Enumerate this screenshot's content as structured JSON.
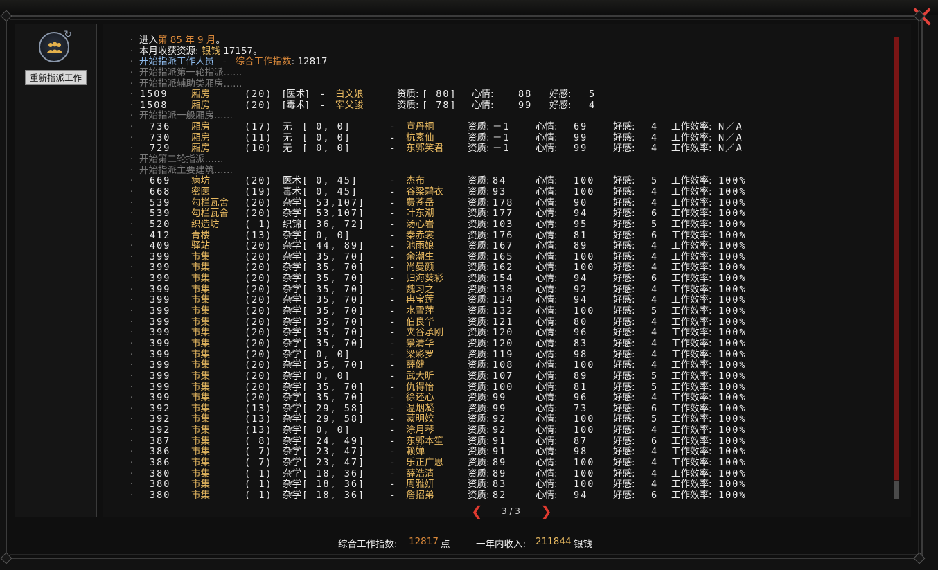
{
  "left_panel": {
    "reassign_label": "重新指派工作",
    "reassign_icon": "people-refresh-icon"
  },
  "log": [
    {
      "t": "text",
      "parts": [
        {
          "s": "进入",
          "c": "white"
        },
        {
          "s": "第 85 年 9 月",
          "c": "orange"
        },
        {
          "s": "。",
          "c": "white"
        }
      ]
    },
    {
      "t": "text",
      "parts": [
        {
          "s": "本月收获资源: ",
          "c": "white"
        },
        {
          "s": "银钱",
          "c": "gold"
        },
        {
          "s": " 17157。",
          "c": "white"
        }
      ]
    },
    {
      "t": "text",
      "parts": [
        {
          "s": "开始指派工作人员",
          "c": "blue"
        },
        {
          "s": "   -   ",
          "c": "gray"
        },
        {
          "s": "综合工作指数",
          "c": "orange"
        },
        {
          "s": ": 12817",
          "c": "white"
        }
      ]
    },
    {
      "t": "text",
      "parts": [
        {
          "s": "开始指派第一轮指派……",
          "c": "gray"
        }
      ]
    },
    {
      "t": "text",
      "parts": [
        {
          "s": "开始指派辅助类厢房……",
          "c": "gray"
        }
      ]
    },
    {
      "t": "aux",
      "id": "1509",
      "b": "厢房",
      "lv": "(20)",
      "skill": "[医术]",
      "name": "白文娘",
      "q": "[  80]",
      "mood": "88",
      "fav": "5"
    },
    {
      "t": "aux",
      "id": "1508",
      "b": "厢房",
      "lv": "(20)",
      "skill": "[毒术]",
      "name": "宰父骏",
      "q": "[  78]",
      "mood": "99",
      "fav": "4"
    },
    {
      "t": "text",
      "parts": [
        {
          "s": "开始指派一般厢房……",
          "c": "gray"
        }
      ]
    },
    {
      "t": "row",
      "id": "736",
      "b": "厢房",
      "lv": "(17)",
      "skill": "无",
      "rng": "[   0,    0]",
      "name": "宣丹桐",
      "q": "－1",
      "mood": "69",
      "fav": "4",
      "eff": "N／A"
    },
    {
      "t": "row",
      "id": "730",
      "b": "厢房",
      "lv": "(11)",
      "skill": "无",
      "rng": "[   0,    0]",
      "name": "杭素仙",
      "q": "－1",
      "mood": "99",
      "fav": "4",
      "eff": "N／A"
    },
    {
      "t": "row",
      "id": "729",
      "b": "厢房",
      "lv": "(10)",
      "skill": "无",
      "rng": "[   0,    0]",
      "name": "东郭笑君",
      "q": "－1",
      "mood": "99",
      "fav": "4",
      "eff": "N／A"
    },
    {
      "t": "text",
      "parts": [
        {
          "s": "开始第二轮指派……",
          "c": "gray"
        }
      ]
    },
    {
      "t": "text",
      "parts": [
        {
          "s": "开始指派主要建筑……",
          "c": "gray"
        }
      ]
    },
    {
      "t": "row",
      "id": "669",
      "b": "病坊",
      "lv": "(20)",
      "skill": "医术",
      "rng": "[   0,  45]",
      "name": "杰布",
      "q": "84",
      "mood": "100",
      "fav": "5",
      "eff": "100%"
    },
    {
      "t": "row",
      "id": "668",
      "b": "密医",
      "lv": "(19)",
      "skill": "毒术",
      "rng": "[   0,  45]",
      "name": "谷梁碧衣",
      "q": "93",
      "mood": "100",
      "fav": "4",
      "eff": "100%"
    },
    {
      "t": "row",
      "id": "539",
      "b": "勾栏瓦舍",
      "lv": "(20)",
      "skill": "杂学",
      "rng": "[ 53,107]",
      "name": "费苍岳",
      "q": "178",
      "mood": "90",
      "fav": "4",
      "eff": "100%"
    },
    {
      "t": "row",
      "id": "539",
      "b": "勾栏瓦舍",
      "lv": "(20)",
      "skill": "杂学",
      "rng": "[ 53,107]",
      "name": "叶东潮",
      "q": "177",
      "mood": "94",
      "fav": "6",
      "eff": "100%"
    },
    {
      "t": "row",
      "id": "520",
      "b": "织造坊",
      "lv": "(  1)",
      "skill": "织锦",
      "rng": "[ 36,  72]",
      "name": "汤心岩",
      "q": "103",
      "mood": "95",
      "fav": "5",
      "eff": "100%"
    },
    {
      "t": "row",
      "id": "412",
      "b": "青楼",
      "lv": "(13)",
      "skill": "杂学",
      "rng": "[   0,    0]",
      "name": "秦赤裳",
      "q": "176",
      "mood": "81",
      "fav": "6",
      "eff": "100%"
    },
    {
      "t": "row",
      "id": "409",
      "b": "驿站",
      "lv": "(20)",
      "skill": "杂学",
      "rng": "[ 44,  89]",
      "name": "池雨娘",
      "q": "167",
      "mood": "89",
      "fav": "4",
      "eff": "100%"
    },
    {
      "t": "row",
      "id": "399",
      "b": "市集",
      "lv": "(20)",
      "skill": "杂学",
      "rng": "[ 35,  70]",
      "name": "余潮生",
      "q": "165",
      "mood": "100",
      "fav": "4",
      "eff": "100%"
    },
    {
      "t": "row",
      "id": "399",
      "b": "市集",
      "lv": "(20)",
      "skill": "杂学",
      "rng": "[ 35,  70]",
      "name": "尚曼颜",
      "q": "162",
      "mood": "100",
      "fav": "4",
      "eff": "100%"
    },
    {
      "t": "row",
      "id": "399",
      "b": "市集",
      "lv": "(20)",
      "skill": "杂学",
      "rng": "[ 35,  70]",
      "name": "归海葵彩",
      "q": "154",
      "mood": "94",
      "fav": "6",
      "eff": "100%"
    },
    {
      "t": "row",
      "id": "399",
      "b": "市集",
      "lv": "(20)",
      "skill": "杂学",
      "rng": "[ 35,  70]",
      "name": "魏习之",
      "q": "138",
      "mood": "92",
      "fav": "4",
      "eff": "100%"
    },
    {
      "t": "row",
      "id": "399",
      "b": "市集",
      "lv": "(20)",
      "skill": "杂学",
      "rng": "[ 35,  70]",
      "name": "冉宝莲",
      "q": "134",
      "mood": "94",
      "fav": "4",
      "eff": "100%"
    },
    {
      "t": "row",
      "id": "399",
      "b": "市集",
      "lv": "(20)",
      "skill": "杂学",
      "rng": "[ 35,  70]",
      "name": "水雪萍",
      "q": "132",
      "mood": "100",
      "fav": "5",
      "eff": "100%"
    },
    {
      "t": "row",
      "id": "399",
      "b": "市集",
      "lv": "(20)",
      "skill": "杂学",
      "rng": "[ 35,  70]",
      "name": "伯良华",
      "q": "121",
      "mood": "80",
      "fav": "4",
      "eff": "100%"
    },
    {
      "t": "row",
      "id": "399",
      "b": "市集",
      "lv": "(20)",
      "skill": "杂学",
      "rng": "[ 35,  70]",
      "name": "夹谷承刚",
      "q": "120",
      "mood": "96",
      "fav": "4",
      "eff": "100%"
    },
    {
      "t": "row",
      "id": "399",
      "b": "市集",
      "lv": "(20)",
      "skill": "杂学",
      "rng": "[ 35,  70]",
      "name": "景清华",
      "q": "120",
      "mood": "83",
      "fav": "4",
      "eff": "100%"
    },
    {
      "t": "row",
      "id": "399",
      "b": "市集",
      "lv": "(20)",
      "skill": "杂学",
      "rng": "[   0,    0]",
      "name": "梁彩罗",
      "q": "119",
      "mood": "98",
      "fav": "4",
      "eff": "100%"
    },
    {
      "t": "row",
      "id": "399",
      "b": "市集",
      "lv": "(20)",
      "skill": "杂学",
      "rng": "[ 35,  70]",
      "name": "薛健",
      "q": "108",
      "mood": "100",
      "fav": "4",
      "eff": "100%"
    },
    {
      "t": "row",
      "id": "399",
      "b": "市集",
      "lv": "(20)",
      "skill": "杂学",
      "rng": "[   0,    0]",
      "name": "武大昕",
      "q": "107",
      "mood": "89",
      "fav": "5",
      "eff": "100%"
    },
    {
      "t": "row",
      "id": "399",
      "b": "市集",
      "lv": "(20)",
      "skill": "杂学",
      "rng": "[ 35,  70]",
      "name": "仇得怡",
      "q": "100",
      "mood": "81",
      "fav": "5",
      "eff": "100%"
    },
    {
      "t": "row",
      "id": "399",
      "b": "市集",
      "lv": "(20)",
      "skill": "杂学",
      "rng": "[ 35,  70]",
      "name": "徐还心",
      "q": "99",
      "mood": "96",
      "fav": "4",
      "eff": "100%"
    },
    {
      "t": "row",
      "id": "392",
      "b": "市集",
      "lv": "(13)",
      "skill": "杂学",
      "rng": "[ 29,  58]",
      "name": "温烟凝",
      "q": "99",
      "mood": "73",
      "fav": "6",
      "eff": "100%"
    },
    {
      "t": "row",
      "id": "392",
      "b": "市集",
      "lv": "(13)",
      "skill": "杂学",
      "rng": "[ 29,  58]",
      "name": "蒙明姣",
      "q": "92",
      "mood": "100",
      "fav": "5",
      "eff": "100%"
    },
    {
      "t": "row",
      "id": "392",
      "b": "市集",
      "lv": "(13)",
      "skill": "杂学",
      "rng": "[   0,    0]",
      "name": "涂月琴",
      "q": "92",
      "mood": "100",
      "fav": "4",
      "eff": "100%"
    },
    {
      "t": "row",
      "id": "387",
      "b": "市集",
      "lv": "(  8)",
      "skill": "杂学",
      "rng": "[ 24,  49]",
      "name": "东郭本笙",
      "q": "91",
      "mood": "87",
      "fav": "6",
      "eff": "100%"
    },
    {
      "t": "row",
      "id": "386",
      "b": "市集",
      "lv": "(  7)",
      "skill": "杂学",
      "rng": "[ 23,  47]",
      "name": "赖婵",
      "q": "91",
      "mood": "98",
      "fav": "4",
      "eff": "100%"
    },
    {
      "t": "row",
      "id": "386",
      "b": "市集",
      "lv": "(  7)",
      "skill": "杂学",
      "rng": "[ 23,  47]",
      "name": "乐正广思",
      "q": "89",
      "mood": "100",
      "fav": "4",
      "eff": "100%"
    },
    {
      "t": "row",
      "id": "380",
      "b": "市集",
      "lv": "(  1)",
      "skill": "杂学",
      "rng": "[ 18,  36]",
      "name": "薛浩清",
      "q": "89",
      "mood": "100",
      "fav": "4",
      "eff": "100%"
    },
    {
      "t": "row",
      "id": "380",
      "b": "市集",
      "lv": "(  1)",
      "skill": "杂学",
      "rng": "[ 18,  36]",
      "name": "周雅妍",
      "q": "83",
      "mood": "100",
      "fav": "4",
      "eff": "100%"
    },
    {
      "t": "row",
      "id": "380",
      "b": "市集",
      "lv": "(  1)",
      "skill": "杂学",
      "rng": "[ 18,  36]",
      "name": "詹招弟",
      "q": "82",
      "mood": "94",
      "fav": "6",
      "eff": "100%"
    }
  ],
  "labels": {
    "q": "资质:",
    "mood": "心情:",
    "fav": "好感:",
    "eff": "工作效率:",
    "dash": "-"
  },
  "pager": {
    "text": "3 / 3",
    "prev": "❮",
    "next": "❯"
  },
  "footer": {
    "index_label": "综合工作指数:",
    "index_value": "12817",
    "index_unit": "点",
    "income_label": "一年内收入:",
    "income_value": "211844",
    "income_unit": "银钱"
  },
  "colors": {
    "accent_orange": "#d9883a",
    "accent_gold": "#e6b860",
    "link_blue": "#8db9ea",
    "close_red": "#e0413a"
  }
}
